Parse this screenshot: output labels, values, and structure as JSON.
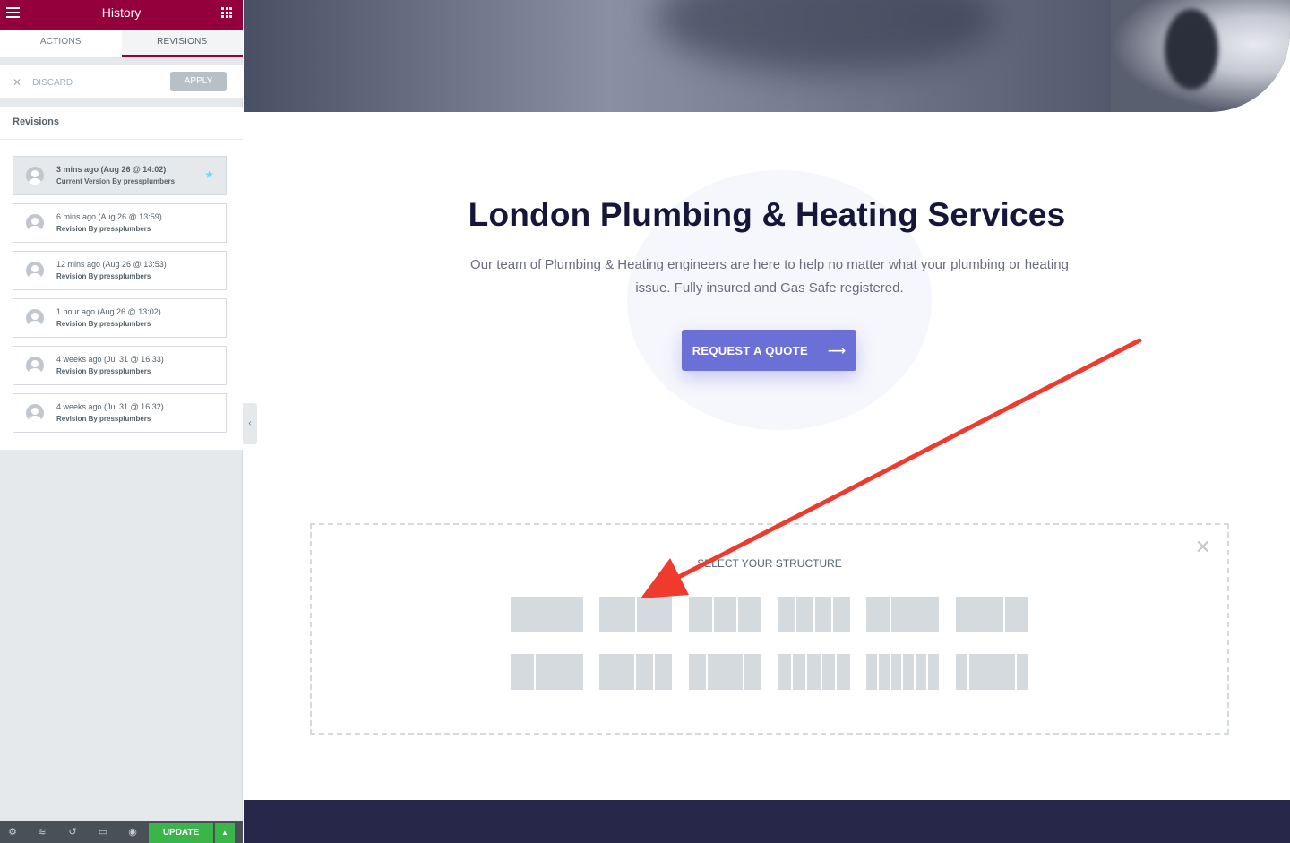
{
  "sidebar": {
    "title": "History",
    "tabs": [
      {
        "label": "ACTIONS",
        "active": false
      },
      {
        "label": "REVISIONS",
        "active": true
      }
    ],
    "discard_label": "DISCARD",
    "apply_label": "APPLY",
    "revisions_heading": "Revisions",
    "revisions": [
      {
        "date": "3 mins ago (Aug 26 @ 14:02)",
        "by": "Current Version By pressplumbers",
        "current": true
      },
      {
        "date": "6 mins ago (Aug 26 @ 13:59)",
        "by": "Revision By pressplumbers",
        "current": false
      },
      {
        "date": "12 mins ago (Aug 26 @ 13:53)",
        "by": "Revision By pressplumbers",
        "current": false
      },
      {
        "date": "1 hour ago (Aug 26 @ 13:02)",
        "by": "Revision By pressplumbers",
        "current": false
      },
      {
        "date": "4 weeks ago (Jul 31 @ 16:33)",
        "by": "Revision By pressplumbers",
        "current": false
      },
      {
        "date": "4 weeks ago (Jul 31 @ 16:32)",
        "by": "Revision By pressplumbers",
        "current": false
      }
    ],
    "bottom": {
      "update_label": "UPDATE",
      "icons": [
        "gear-icon",
        "layers-icon",
        "history-icon",
        "responsive-icon",
        "eye-icon"
      ]
    }
  },
  "canvas": {
    "title": "London Plumbing & Heating Services",
    "subtitle": "Our team of Plumbing & Heating engineers are here to help no matter what your plumbing or heating issue. Fully insured and Gas Safe registered.",
    "cta_label": "REQUEST A QUOTE",
    "structure": {
      "label": "SELECT YOUR STRUCTURE",
      "presets": [
        [
          1
        ],
        [
          1,
          1
        ],
        [
          1,
          1,
          1
        ],
        [
          1,
          1,
          1,
          1
        ],
        [
          1,
          2
        ],
        [
          2,
          1
        ],
        [
          1,
          2
        ],
        [
          2,
          1,
          1
        ],
        [
          1,
          2,
          1
        ],
        [
          1,
          1,
          1,
          1,
          1
        ],
        [
          1,
          1,
          1,
          1,
          1,
          1
        ],
        [
          1,
          4,
          1
        ]
      ]
    }
  },
  "colors": {
    "brand": "#93003c",
    "cta": "#6b70d6",
    "update": "#39b54a",
    "footer": "#27274a",
    "annotation_arrow": "#ef3b2d"
  }
}
